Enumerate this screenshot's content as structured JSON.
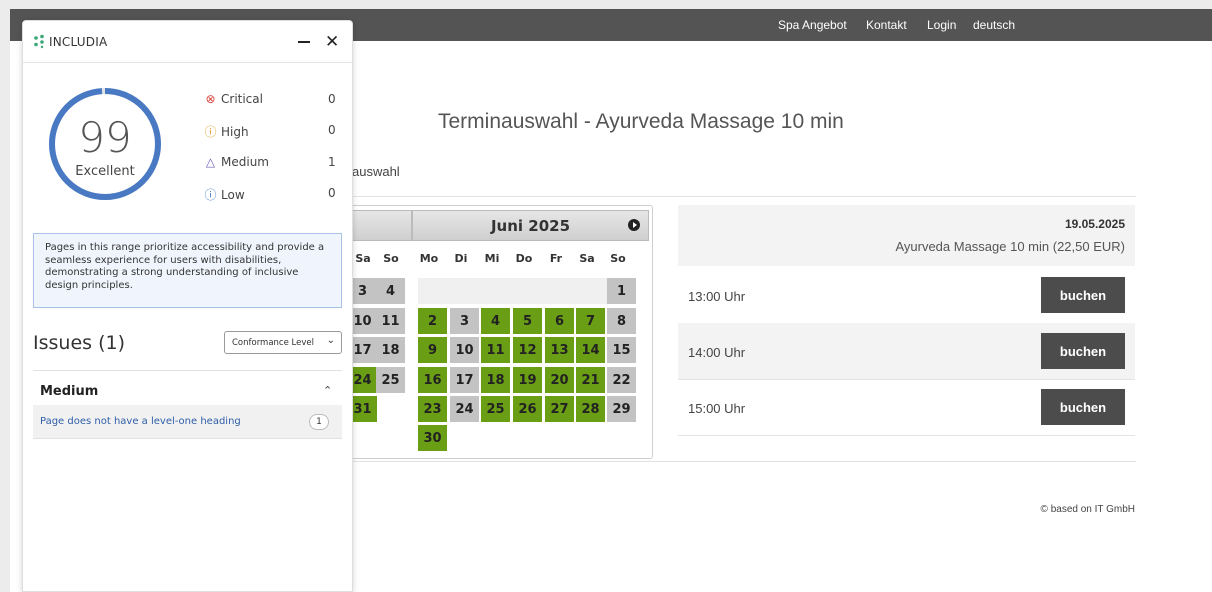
{
  "topnav": {
    "items": [
      "Spa Angebot",
      "Kontakt",
      "Login",
      "deutsch"
    ]
  },
  "page": {
    "title": "Terminauswahl - Ayurveda Massage 10 min",
    "subtitle_fragment": "auswahl",
    "footer": "© based on IT GmbH"
  },
  "calendar": {
    "prev_month_weekday_headers": [
      "Sa",
      "So"
    ],
    "prev_month_days": [
      [
        "3",
        "4"
      ],
      [
        "10",
        "11"
      ],
      [
        "17",
        "18"
      ],
      [
        "24",
        "25"
      ],
      [
        "31",
        ""
      ]
    ],
    "month_title": "Juni 2025",
    "weekday_headers": [
      "Mo",
      "Di",
      "Mi",
      "Do",
      "Fr",
      "Sa",
      "So"
    ],
    "june_weeks": [
      [
        "",
        "",
        "",
        "",
        "",
        "",
        "1"
      ],
      [
        "2",
        "3",
        "4",
        "5",
        "6",
        "7",
        "8"
      ],
      [
        "9",
        "10",
        "11",
        "12",
        "13",
        "14",
        "15"
      ],
      [
        "16",
        "17",
        "18",
        "19",
        "20",
        "21",
        "22"
      ],
      [
        "23",
        "24",
        "25",
        "26",
        "27",
        "28",
        "29"
      ],
      [
        "30",
        "",
        "",
        "",
        "",
        "",
        ""
      ]
    ],
    "available_color": "#6a9e15",
    "unavailable_color": "#c3c3c3"
  },
  "booking": {
    "date": "19.05.2025",
    "service": "Ayurveda Massage 10 min (22,50 EUR)",
    "slots": [
      {
        "time": "13:00 Uhr",
        "button": "buchen"
      },
      {
        "time": "14:00 Uhr",
        "button": "buchen"
      },
      {
        "time": "15:00 Uhr",
        "button": "buchen"
      }
    ]
  },
  "includia": {
    "brand": "INCLUDIA",
    "score": "99",
    "rating": "Excellent",
    "score_color": "#4a79c4",
    "severities": [
      {
        "label": "Critical",
        "count": "0",
        "icon": "x-circle-icon",
        "color": "#d9463f"
      },
      {
        "label": "High",
        "count": "0",
        "icon": "alert-circle-icon",
        "color": "#e09a1f"
      },
      {
        "label": "Medium",
        "count": "1",
        "icon": "warning-triangle-icon",
        "color": "#6c5fb5"
      },
      {
        "label": "Low",
        "count": "0",
        "icon": "info-circle-icon",
        "color": "#3f78c8"
      }
    ],
    "description": "Pages in this range prioritize accessibility and provide a seamless experience for users with disabilities, demonstrating a strong understanding of inclusive design principles.",
    "issues_title": "Issues (1)",
    "conformance_select": "Conformance Level",
    "group": "Medium",
    "issue": {
      "text": "Page does not have a level-one heading",
      "count": "1"
    }
  }
}
